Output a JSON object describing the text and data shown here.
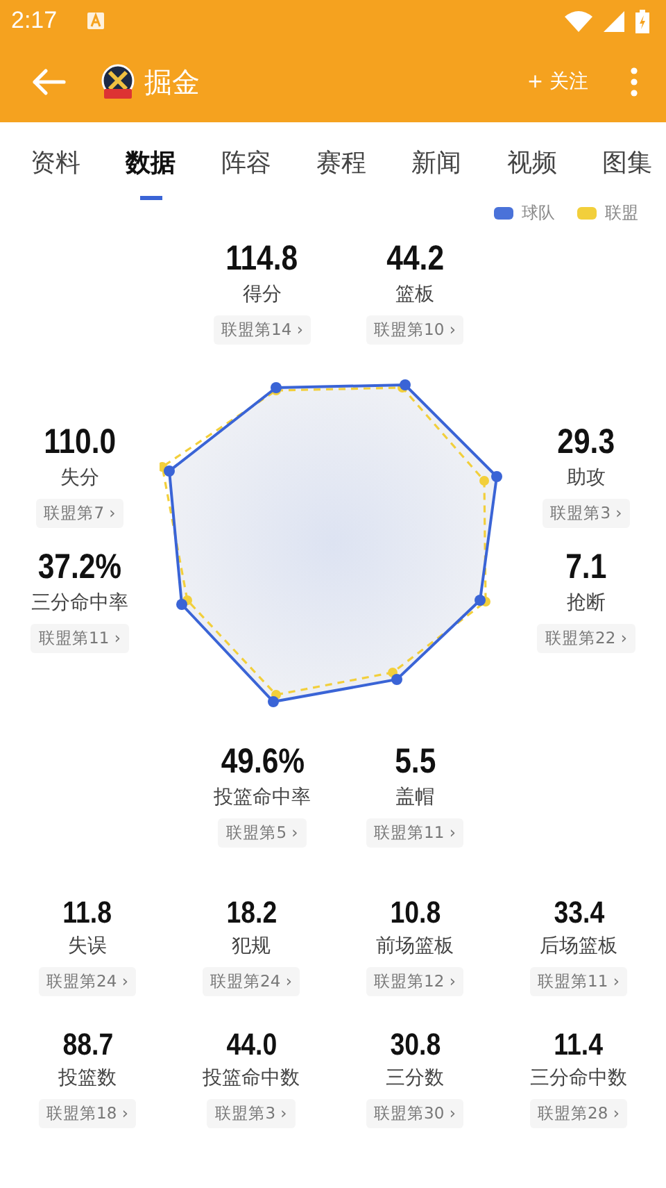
{
  "status_bar": {
    "time": "2:17"
  },
  "app_bar": {
    "title": "掘金",
    "follow": "+ 关注"
  },
  "tabs": [
    {
      "label": "资料",
      "selected": false
    },
    {
      "label": "数据",
      "selected": true
    },
    {
      "label": "阵容",
      "selected": false
    },
    {
      "label": "赛程",
      "selected": false
    },
    {
      "label": "新闻",
      "selected": false
    },
    {
      "label": "视频",
      "selected": false
    },
    {
      "label": "图集",
      "selected": false
    }
  ],
  "legend": [
    {
      "label": "球队",
      "color": "#4a72d9"
    },
    {
      "label": "联盟",
      "color": "#f2cf3b"
    }
  ],
  "radar": {
    "top": [
      {
        "value": "114.8",
        "label": "得分",
        "rank": "联盟第14 ›"
      },
      {
        "value": "44.2",
        "label": "篮板",
        "rank": "联盟第10 ›"
      }
    ],
    "left": [
      {
        "value": "110.0",
        "label": "失分",
        "rank": "联盟第7 ›"
      },
      {
        "value": "37.2%",
        "label": "三分命中率",
        "rank": "联盟第11 ›"
      }
    ],
    "right": [
      {
        "value": "29.3",
        "label": "助攻",
        "rank": "联盟第3 ›"
      },
      {
        "value": "7.1",
        "label": "抢断",
        "rank": "联盟第22 ›"
      }
    ],
    "bottom": [
      {
        "value": "49.6%",
        "label": "投篮命中率",
        "rank": "联盟第5 ›"
      },
      {
        "value": "5.5",
        "label": "盖帽",
        "rank": "联盟第11 ›"
      }
    ]
  },
  "stats": [
    {
      "value": "11.8",
      "label": "失误",
      "rank": "联盟第24 ›"
    },
    {
      "value": "18.2",
      "label": "犯规",
      "rank": "联盟第24 ›"
    },
    {
      "value": "10.8",
      "label": "前场篮板",
      "rank": "联盟第12 ›"
    },
    {
      "value": "33.4",
      "label": "后场篮板",
      "rank": "联盟第11 ›"
    },
    {
      "value": "88.7",
      "label": "投篮数",
      "rank": "联盟第18 ›"
    },
    {
      "value": "44.0",
      "label": "投篮命中数",
      "rank": "联盟第3 ›"
    },
    {
      "value": "30.8",
      "label": "三分数",
      "rank": "联盟第30 ›"
    },
    {
      "value": "11.4",
      "label": "三分命中数",
      "rank": "联盟第28 ›"
    }
  ]
}
